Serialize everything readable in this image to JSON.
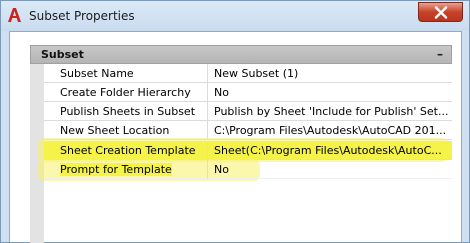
{
  "window": {
    "title": "Subset Properties"
  },
  "section": {
    "title": "Subset",
    "collapse_glyph": "–"
  },
  "properties": [
    {
      "name": "Subset Name",
      "value": "New Subset (1)"
    },
    {
      "name": "Create Folder Hierarchy",
      "value": "No"
    },
    {
      "name": "Publish Sheets in Subset",
      "value": "Publish by Sheet 'Include for Publish' Set..."
    },
    {
      "name": "New Sheet Location",
      "value": "C:\\Program Files\\Autodesk\\AutoCAD 201..."
    },
    {
      "name": "Sheet Creation Template",
      "value": "Sheet(C:\\Program Files\\Autodesk\\AutoC..."
    },
    {
      "name": "Prompt for Template",
      "value": "No"
    }
  ],
  "colors": {
    "highlight": "#f5f24a",
    "close_button": "#c7432a"
  },
  "icons": {
    "app": "autocad-logo-icon",
    "close": "close-icon"
  }
}
